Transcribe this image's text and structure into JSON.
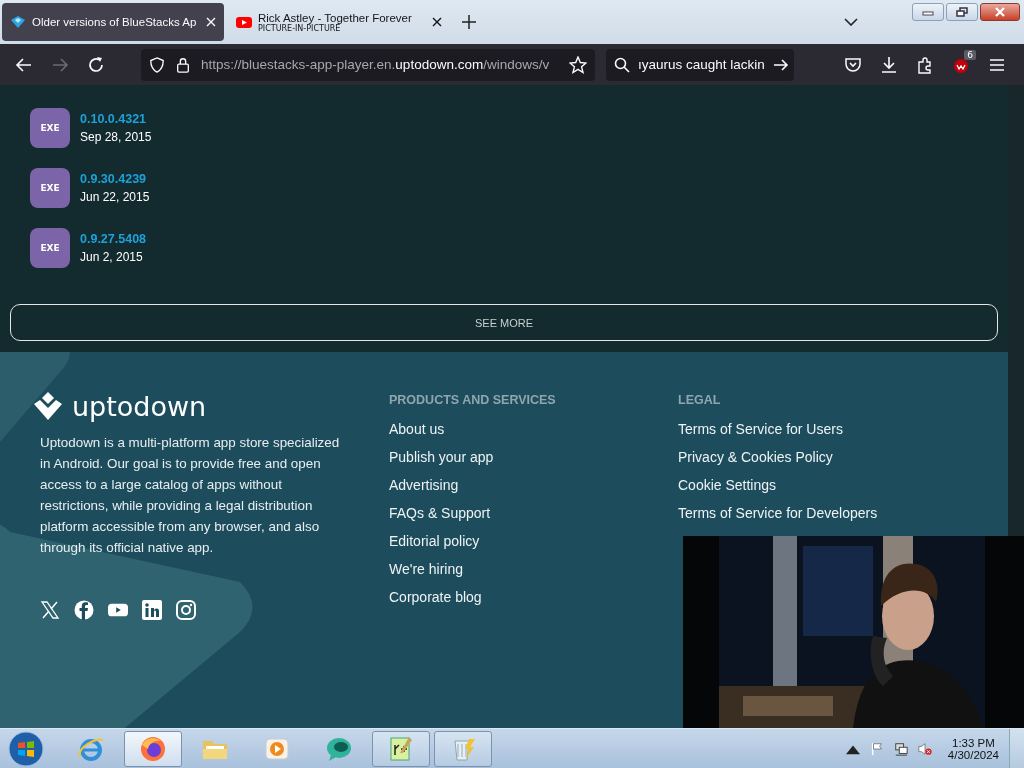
{
  "tabs": [
    {
      "title": "Older versions of BlueStacks Ap",
      "kind": "site",
      "selected": true
    },
    {
      "title": "Rick Astley - Together Forever",
      "subtitle": "PICTURE-IN-PICTURE",
      "kind": "video",
      "selected": false
    }
  ],
  "toolbar": {
    "forward_disabled": true,
    "url_prefix": "https://bluestacks-app-player.en.",
    "url_host": "uptodown.com",
    "url_rest": "/windows/v",
    "search_value": "ıyaurus caught lackin",
    "extension_badge": "6"
  },
  "versions": [
    {
      "icon_label": "EXE",
      "version": "0.10.0.4321",
      "date": "Sep 28, 2015"
    },
    {
      "icon_label": "EXE",
      "version": "0.9.30.4239",
      "date": "Jun 22, 2015"
    },
    {
      "icon_label": "EXE",
      "version": "0.9.27.5408",
      "date": "Jun 2, 2015"
    }
  ],
  "see_more": "SEE MORE",
  "footer": {
    "logo_text": "uptodown",
    "description": "Uptodown is a multi-platform app store specialized in Android. Our goal is to provide free and open access to a large catalog of apps without restrictions, while providing a legal distribution platform accessible from any browser, and also through its official native app.",
    "columns": [
      {
        "heading": "PRODUCTS AND SERVICES",
        "links": [
          "About us",
          "Publish your app",
          "Advertising",
          "FAQs & Support",
          "Editorial policy",
          "We're hiring",
          "Corporate blog"
        ]
      },
      {
        "heading": "LEGAL",
        "links": [
          "Terms of Service for Users",
          "Privacy & Cookies Policy",
          "Cookie Settings",
          "Terms of Service for Developers"
        ]
      }
    ]
  },
  "taskbar": {
    "items": [
      {
        "kind": "ie",
        "running": false,
        "selected": false
      },
      {
        "kind": "firefox",
        "running": true,
        "selected": true
      },
      {
        "kind": "folder",
        "running": false,
        "selected": false
      },
      {
        "kind": "media",
        "running": false,
        "selected": false
      },
      {
        "kind": "chat",
        "running": false,
        "selected": false
      },
      {
        "kind": "editor",
        "running": true,
        "selected": false
      },
      {
        "kind": "archive",
        "running": true,
        "selected": false
      }
    ],
    "time": "1:33 PM",
    "date": "4/30/2024"
  }
}
